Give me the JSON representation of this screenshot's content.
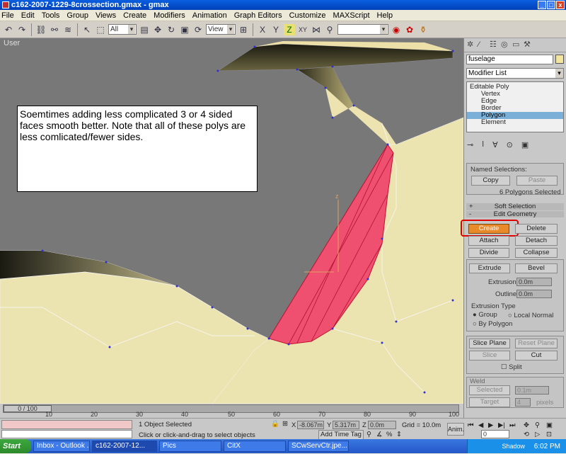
{
  "window": {
    "title": "c162-2007-1229-8crossection.gmax - gmax",
    "min": "_",
    "max": "□",
    "close": "x"
  },
  "menu": [
    "File",
    "Edit",
    "Tools",
    "Group",
    "Views",
    "Create",
    "Modifiers",
    "Animation",
    "Graph Editors",
    "Customize",
    "MAXScript",
    "Help"
  ],
  "toolbar": {
    "selection_filter": "All",
    "reference_coord": "View",
    "named_sel": ""
  },
  "viewport": {
    "label": "User",
    "note": "Soemtimes adding less complicated 3 or 4 sided faces smooth better.  Note that all of these polys are less comlicated/fewer sides.",
    "gizmo_axis": "z"
  },
  "panel": {
    "object_name": "fuselage",
    "modifier_list": "Modifier List",
    "stack": [
      "Editable Poly",
      "Vertex",
      "Edge",
      "Border",
      "Polygon",
      "Element"
    ],
    "named_selections_title": "Named Selections:",
    "copy": "Copy",
    "paste": "Paste",
    "selected_count": "6 Polygons Selected",
    "soft_selection": "Soft Selection",
    "edit_geometry": "Edit Geometry",
    "create": "Create",
    "delete": "Delete",
    "attach": "Attach",
    "detach": "Detach",
    "divide": "Divide",
    "collapse": "Collapse",
    "extrude": "Extrude",
    "bevel": "Bevel",
    "extrusion_label": "Extrusion:",
    "extrusion_value": "0.0m",
    "outline_label": "Outline",
    "outline_value": "0.0m",
    "extrusion_type": "Extrusion Type",
    "group": "Group",
    "local_normal": "Local Normal",
    "by_polygon": "By Polygon",
    "slice_plane": "Slice Plane",
    "reset_plane": "Reset Plane",
    "slice": "Slice",
    "cut": "Cut",
    "split": "Split",
    "weld": "Weld",
    "selected": "Selected",
    "selected_value": "0.1m",
    "target": "Target",
    "target_value": "4",
    "pixels": "pixels"
  },
  "timeline": {
    "frame": "0 / 100",
    "ticks": [
      "10",
      "20",
      "30",
      "40",
      "50",
      "60",
      "70",
      "80",
      "90",
      "100"
    ]
  },
  "status": {
    "selected": "1 Object Selected",
    "prompt": "Click or click-and-drag to select objects",
    "x_label": "X",
    "x_value": "-8.067m",
    "y_label": "Y",
    "y_value": "5.317m",
    "z_label": "Z",
    "z_value": "0.0m",
    "grid": "Grid = 10.0m",
    "add_time_tag": "Add Time Tag",
    "anim": "Anim.",
    "frame_field": "0"
  },
  "taskbar": {
    "start": "Start",
    "tasks": [
      "Inbox - Outlook ...",
      "c162-2007-12...",
      "Pics",
      "CitX",
      "SCwServCtr.jpe...",
      "Shadow"
    ],
    "clock": "6:02 PM"
  }
}
